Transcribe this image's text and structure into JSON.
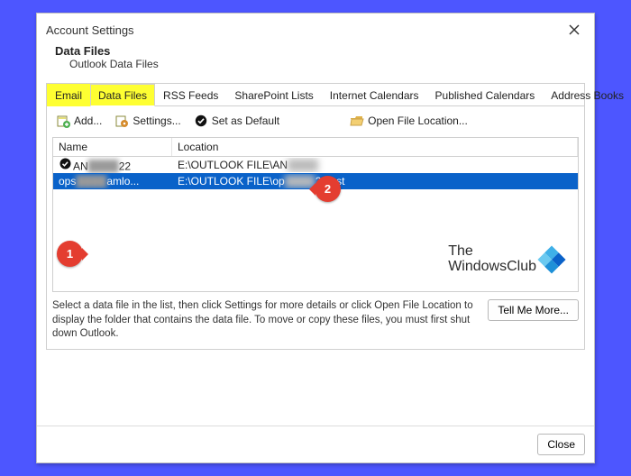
{
  "window": {
    "title": "Account Settings"
  },
  "section": {
    "heading": "Data Files",
    "sub": "Outlook Data Files"
  },
  "tabs": {
    "items": [
      "Email",
      "Data Files",
      "RSS Feeds",
      "SharePoint Lists",
      "Internet Calendars",
      "Published Calendars",
      "Address Books"
    ],
    "highlight": [
      0,
      1
    ],
    "active": 1
  },
  "toolbar": {
    "add": "Add...",
    "settings": "Settings...",
    "setdef": "Set as Default",
    "openloc": "Open File Location..."
  },
  "table": {
    "headers": {
      "name": "Name",
      "location": "Location"
    },
    "rows": [
      {
        "selected": false,
        "checked": true,
        "name_vis": "AN",
        "name_blur": "████",
        "name_suffix": "22",
        "loc_vis": "E:\\OUTLOOK FILE\\AN",
        "loc_blur": "████",
        "loc_suffix": ""
      },
      {
        "selected": true,
        "checked": false,
        "name_vis": "ops",
        "name_blur": "████",
        "name_suffix": "amlo...",
        "loc_vis": "E:\\OUTLOOK FILE\\op",
        "loc_blur": "████",
        "loc_suffix": "22.pst"
      }
    ]
  },
  "watermark": {
    "line1": "The",
    "line2": "WindowsClub"
  },
  "hint": {
    "text": "Select a data file in the list, then click Settings for more details or click Open File Location to display the folder that contains the data file. To move or copy these files, you must first shut down Outlook.",
    "more": "Tell Me More..."
  },
  "footer": {
    "close": "Close"
  },
  "callouts": {
    "one": "1",
    "two": "2"
  }
}
